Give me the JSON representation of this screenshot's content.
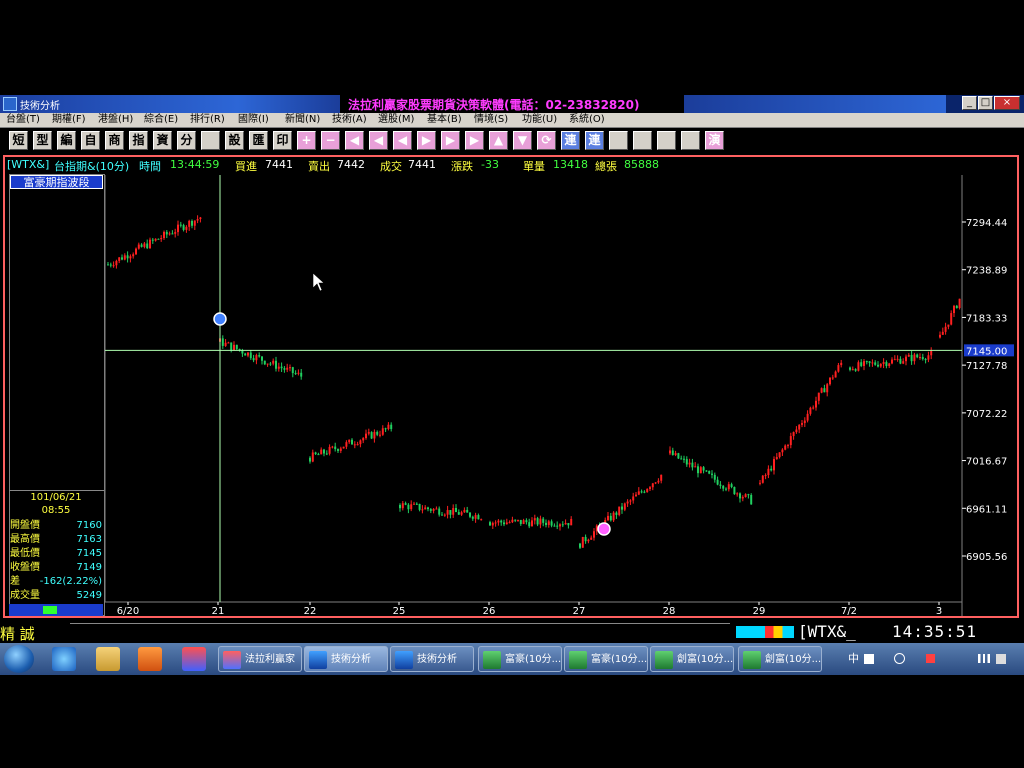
{
  "window": {
    "app_title": "技術分析",
    "brand_title": "法拉利贏家股票期貨決策軟體(電話：02-23832820)",
    "controls": [
      "_",
      "□",
      "×"
    ]
  },
  "menu": [
    "台盤(T)",
    "期權(F)",
    "港盤(H)",
    "綜合(E)",
    "排行(R)",
    "國際(I)",
    "新聞(N)",
    "技術(A)",
    "選股(M)",
    "基本(B)",
    "情境(S)",
    "功能(U)",
    "系統(O)"
  ],
  "toolbar": {
    "text_buttons": [
      "短",
      "型",
      "編",
      "自",
      "商",
      "指",
      "資",
      "分"
    ],
    "text_buttons2": [
      "設",
      "匯",
      "印"
    ],
    "icon_buttons": [
      "chart-icon",
      "plus-icon",
      "minus-icon",
      "arrow-left-icon",
      "arrow-left-2-icon",
      "arrow-left-3-icon",
      "arrow-right-icon",
      "arrow-right-2-icon",
      "arrow-right-3-icon",
      "arrow-up-icon",
      "arrow-down-icon",
      "refresh-icon"
    ],
    "text_buttons3": [
      "連",
      "連"
    ],
    "icon_buttons2": [
      "notepad-icon",
      "lock-icon",
      "scissors-icon",
      "edit-icon"
    ],
    "last_button": "演"
  },
  "infobar": {
    "symbol": "[WTX&]",
    "name": "台指期&(10分)",
    "time_label": "時間",
    "time": "13:44:59",
    "bid_label": "買進",
    "bid": "7441",
    "ask_label": "賣出",
    "ask": "7442",
    "trade_label": "成交",
    "trade": "7441",
    "change_label": "漲跌",
    "change": "-33",
    "volume_label": "單量",
    "volume": "13418",
    "total_label": "總張",
    "total": "85888"
  },
  "left_panel": {
    "wave_label": "富豪期指波段",
    "date": "101/06/21",
    "time": "08:55",
    "rows": [
      {
        "label": "開盤價",
        "value": "7160"
      },
      {
        "label": "最高價",
        "value": "7163"
      },
      {
        "label": "最低價",
        "value": "7145"
      },
      {
        "label": "收盤價",
        "value": "7149"
      },
      {
        "label": "差",
        "value": "-162(2.22%)"
      },
      {
        "label": "成交量",
        "value": "5249"
      }
    ]
  },
  "chart_data": {
    "type": "candlestick",
    "y_ticks": [
      7294.44,
      7238.89,
      7183.33,
      7127.78,
      7072.22,
      7016.67,
      6961.11,
      6905.56
    ],
    "y_tick_labels": [
      "7294.44",
      "7238.89",
      "7183.33",
      "7127.78",
      "7072.22",
      "7016.67",
      "6961.11",
      "6905.56"
    ],
    "ylim": [
      6880,
      7340
    ],
    "x_labels": [
      "6/20",
      "21",
      "22",
      "25",
      "26",
      "27",
      "28",
      "29",
      "7/2",
      "3"
    ],
    "crosshair_value": "7145.00",
    "crosshair_price": 7145,
    "colors": {
      "up": "#ff2020",
      "down": "#20d060",
      "axis": "#ffffff",
      "crosshair": "#b0ffb0",
      "marker": "#4080ff",
      "pink_marker": "#ff60ff"
    },
    "session_levels": [
      {
        "day": "6/20",
        "start": 7245,
        "end": 7300
      },
      {
        "day": "21",
        "start": 7155,
        "end": 7115
      },
      {
        "day": "22",
        "start": 7020,
        "end": 7055
      },
      {
        "day": "25",
        "start": 6965,
        "end": 6952
      },
      {
        "day": "26",
        "start": 6945,
        "end": 6945
      },
      {
        "day": "27",
        "start": 6920,
        "end": 7000
      },
      {
        "day": "28",
        "start": 7025,
        "end": 6970
      },
      {
        "day": "29",
        "start": 6990,
        "end": 7130
      },
      {
        "day": "7/2",
        "start": 7125,
        "end": 7140
      },
      {
        "day": "3",
        "start": 7160,
        "end": 7205
      }
    ]
  },
  "status_bar": {
    "left_text": "精 誠",
    "symbol": "[WTX&_",
    "clock": "14:35:51"
  },
  "taskbar": {
    "tasks": [
      {
        "label": "法拉利贏家",
        "icon": "ferrari-app-icon"
      },
      {
        "label": "技術分析",
        "icon": "chart-app-icon"
      },
      {
        "label": "技術分析",
        "icon": "chart-app-icon"
      },
      {
        "label": "富豪(10分...",
        "icon": "excel-icon"
      },
      {
        "label": "富豪(10分...",
        "icon": "excel-icon"
      },
      {
        "label": "創富(10分...",
        "icon": "excel-icon"
      },
      {
        "label": "創富(10分...",
        "icon": "excel-icon"
      }
    ],
    "tray_lang": "中"
  }
}
